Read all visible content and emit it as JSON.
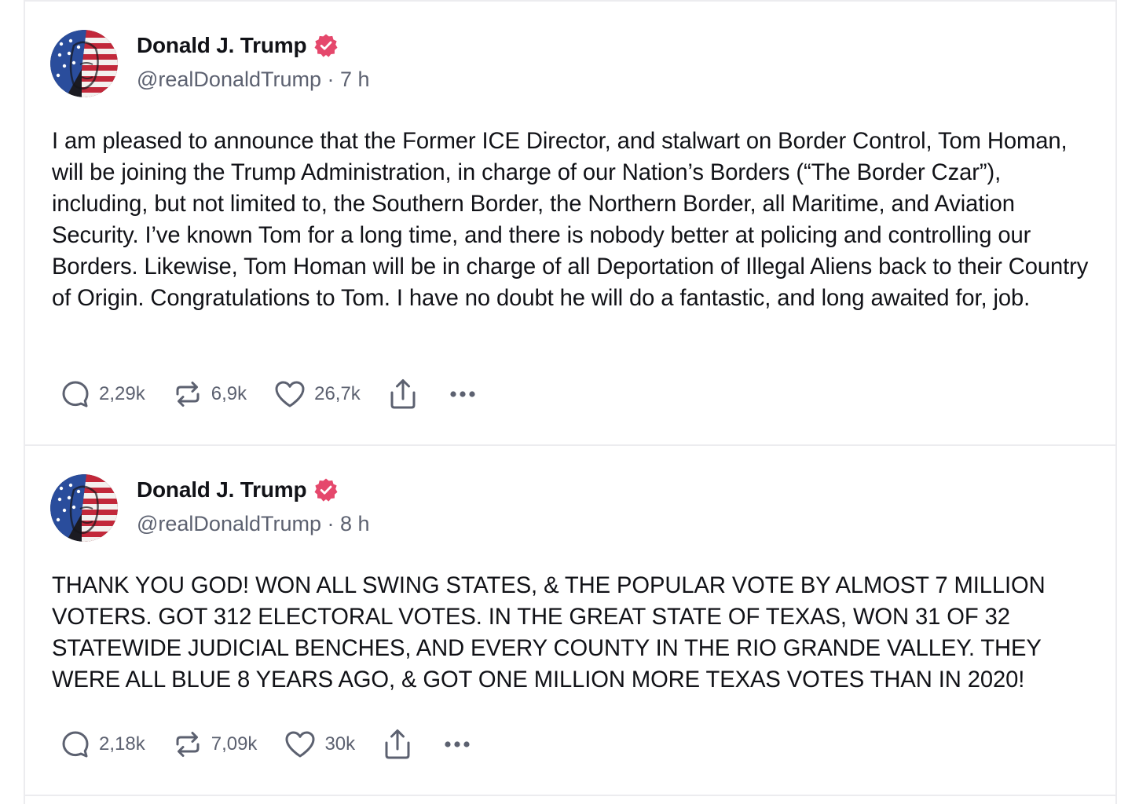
{
  "posts": [
    {
      "author": {
        "name": "Donald J. Trump",
        "handle": "@realDonaldTrump",
        "separator": "·",
        "time": "7 h"
      },
      "body": "I am pleased to announce that the Former ICE Director, and stalwart on Border Control, Tom Homan, will be joining the Trump Administration, in charge of our Nation’s Borders (“The Border Czar”), including, but not limited to, the Southern Border, the Northern Border, all Maritime, and Aviation Security. I’ve known Tom for a long time, and there is nobody better at policing and controlling our Borders. Likewise, Tom Homan will be in charge of all Deportation of Illegal Aliens back to their Country of Origin. Congratulations to Tom. I have no doubt he will do a fantastic, and long awaited for, job.",
      "stats": {
        "replies": "2,29k",
        "reposts": "6,9k",
        "likes": "26,7k"
      }
    },
    {
      "author": {
        "name": "Donald J. Trump",
        "handle": "@realDonaldTrump",
        "separator": "·",
        "time": "8 h"
      },
      "body": "THANK YOU GOD! WON ALL SWING STATES, & THE POPULAR VOTE BY ALMOST 7 MILLION VOTERS. GOT 312 ELECTORAL VOTES. IN THE GREAT STATE OF TEXAS, WON 31 OF 32 STATEWIDE JUDICIAL BENCHES, AND EVERY COUNTY IN THE RIO GRANDE VALLEY. THEY WERE ALL BLUE 8 YEARS AGO, & GOT ONE MILLION MORE TEXAS VOTES THAN IN 2020!",
      "stats": {
        "replies": "2,18k",
        "reposts": "7,09k",
        "likes": "30k"
      }
    }
  ],
  "icons": {
    "reply": "speech-bubble-icon",
    "repost": "repost-arrows-icon",
    "like": "heart-icon",
    "share": "share-upload-icon",
    "more": "ellipsis-icon",
    "verified": "verified-badge-icon"
  },
  "colors": {
    "verified_badge": "#e5486c",
    "text_primary": "#111217",
    "text_secondary": "#5c6170",
    "divider": "#ececef"
  }
}
